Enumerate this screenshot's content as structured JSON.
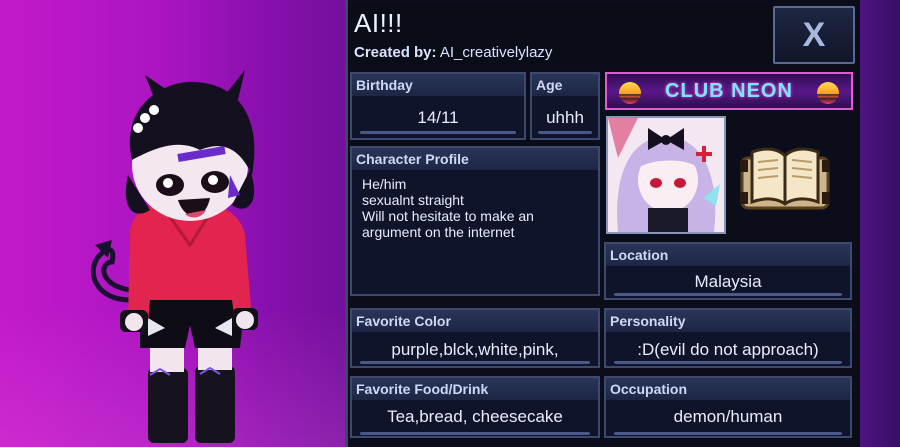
{
  "header": {
    "title": "AI!!!",
    "created_by_label": "Created by:",
    "created_by_value": "AI_creativelylazy",
    "close_label": "X"
  },
  "fields": {
    "birthday": {
      "label": "Birthday",
      "value": "14/11"
    },
    "age": {
      "label": "Age",
      "value": "uhhh"
    },
    "profile": {
      "label": "Character Profile",
      "value": "He/him\nsexualnt straight\nWill not hesitate to make an\nargument on the internet"
    },
    "location": {
      "label": "Location",
      "value": "Malaysia"
    },
    "favorite_color": {
      "label": "Favorite Color",
      "value": "purple,blck,white,pink,"
    },
    "personality": {
      "label": "Personality",
      "value": ":D(evil do not approach)"
    },
    "food": {
      "label": "Favorite Food/Drink",
      "value": "Tea,bread, cheesecake"
    },
    "occupation": {
      "label": "Occupation",
      "value": "demon/human"
    }
  },
  "badge": {
    "label": "CLUB NEON"
  },
  "colors": {
    "panel": "#0b0d1a",
    "box_border": "#3c4a70",
    "text": "#e7edff",
    "stage": "#b212c4"
  },
  "icons": [
    "close-icon",
    "book-icon"
  ]
}
